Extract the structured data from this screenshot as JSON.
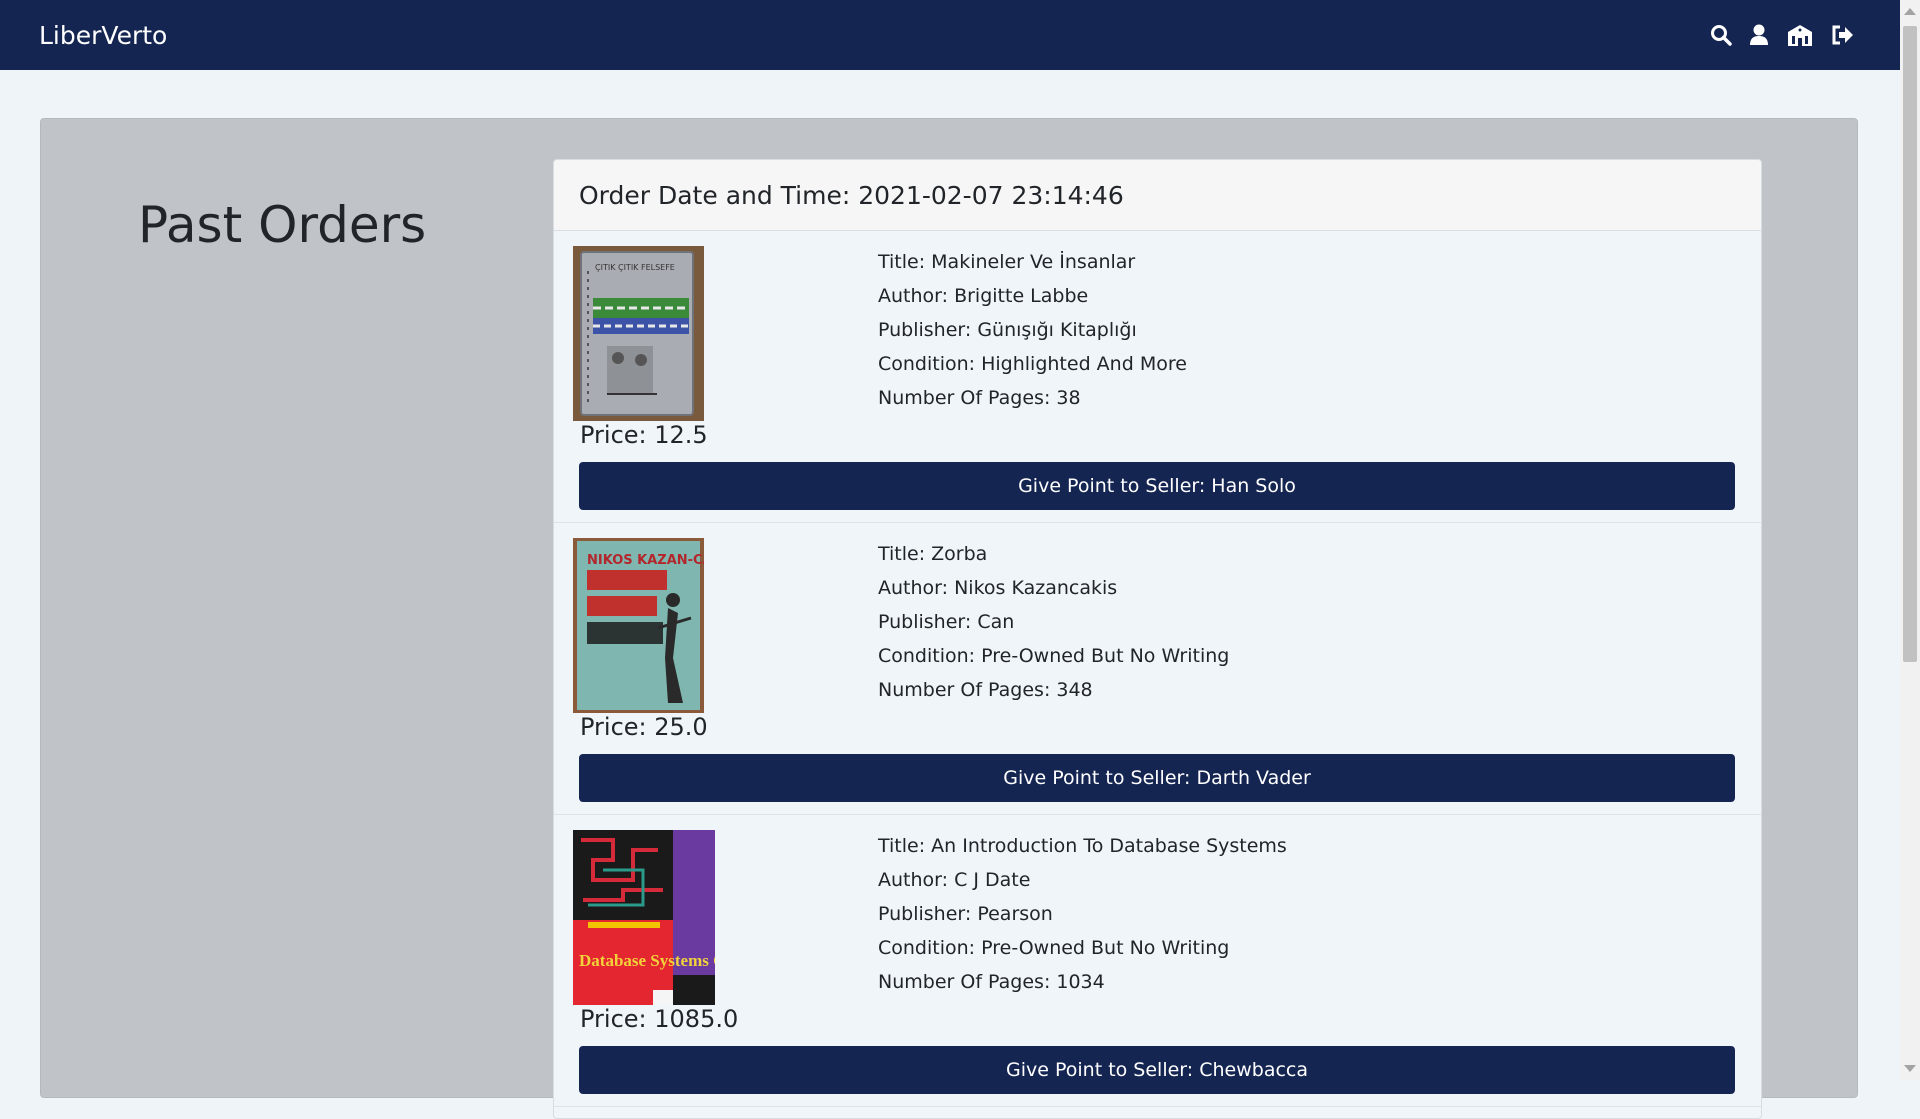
{
  "navbar": {
    "brand": "LiberVerto",
    "icons": [
      "search-icon",
      "user-icon",
      "shop-icon",
      "logout-icon"
    ]
  },
  "page": {
    "title": "Past Orders"
  },
  "order": {
    "header": "Order Date and Time: 2021-02-07 23:14:46",
    "items": [
      {
        "title": "Title: Makineler Ve İnsanlar",
        "author": "Author: Brigitte Labbe",
        "publisher": "Publisher: Günışığı Kitaplığı",
        "condition": "Condition: Highlighted And More",
        "pages": "Number Of Pages: 38",
        "price": "Price: 12.5",
        "button": "Give Point to Seller: Han Solo",
        "cover_text": "ÇITIK ÇITIK FELSEFE"
      },
      {
        "title": "Title: Zorba",
        "author": "Author: Nikos Kazancakis",
        "publisher": "Publisher: Can",
        "condition": "Condition: Pre-Owned But No Writing",
        "pages": "Number Of Pages: 348",
        "price": "Price: 25.0",
        "button": "Give Point to Seller: Darth Vader",
        "cover_text": "NIKOS KAZAN-CAKIS ZORBA"
      },
      {
        "title": "Title: An Introduction To Database Systems",
        "author": "Author: C J Date",
        "publisher": "Publisher: Pearson",
        "condition": "Condition: Pre-Owned But No Writing",
        "pages": "Number Of Pages: 1034",
        "price": "Price: 1085.0",
        "button": "Give Point to Seller: Chewbacca",
        "cover_text": "Database Systems C.J. Date"
      }
    ]
  },
  "colors": {
    "navbar": "#142552",
    "page_background": "#eef4f8",
    "jumbotron": "#c0c4c8",
    "button": "#142552"
  }
}
